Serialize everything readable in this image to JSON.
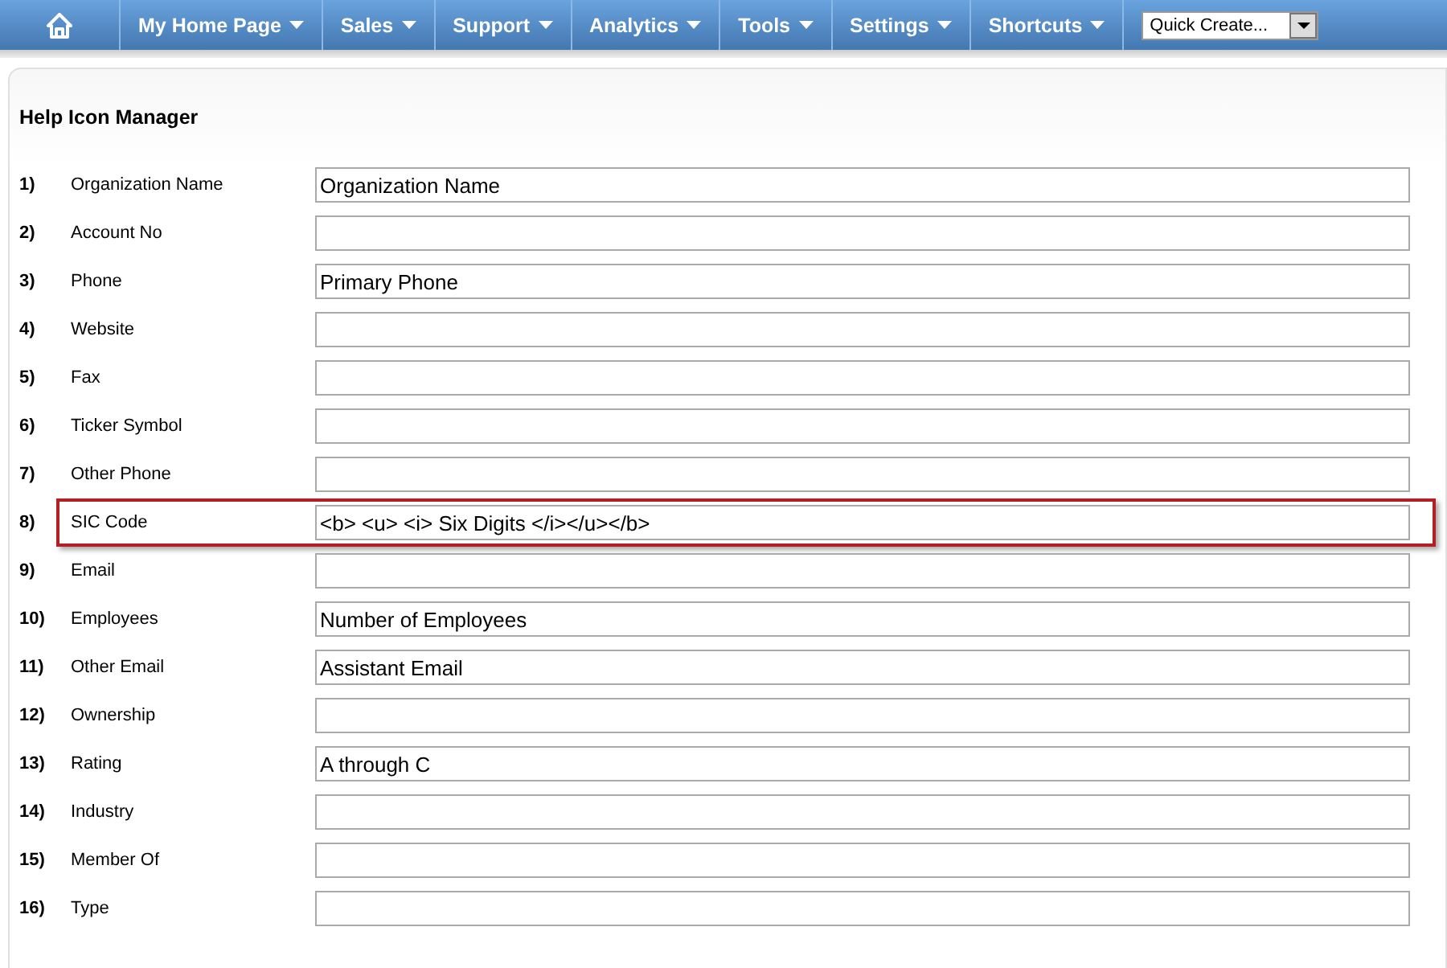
{
  "nav": {
    "items": [
      {
        "label": "My Home Page"
      },
      {
        "label": "Sales"
      },
      {
        "label": "Support"
      },
      {
        "label": "Analytics"
      },
      {
        "label": "Tools"
      },
      {
        "label": "Settings"
      },
      {
        "label": "Shortcuts"
      }
    ],
    "quick_create": "Quick Create..."
  },
  "page": {
    "title": "Help Icon Manager"
  },
  "rows": [
    {
      "number": "1)",
      "label": "Organization Name",
      "value": "Organization Name",
      "highlighted": false
    },
    {
      "number": "2)",
      "label": "Account No",
      "highlighted": false
    },
    {
      "number": "3)",
      "label": "Phone",
      "value": "Primary Phone",
      "highlighted": false
    },
    {
      "number": "4)",
      "label": "Website",
      "highlighted": false
    },
    {
      "number": "5)",
      "label": "Fax",
      "highlighted": false
    },
    {
      "number": "6)",
      "label": "Ticker Symbol",
      "highlighted": false
    },
    {
      "number": "7)",
      "label": "Other Phone",
      "highlighted": false
    },
    {
      "number": "8)",
      "label": "SIC Code",
      "value": "<b> <u> <i> Six Digits </i></u></b>",
      "highlighted": true
    },
    {
      "number": "9)",
      "label": "Email",
      "highlighted": false
    },
    {
      "number": "10)",
      "label": "Employees",
      "value": "Number of Employees",
      "highlighted": false
    },
    {
      "number": "11)",
      "label": "Other Email",
      "value": "Assistant Email",
      "highlighted": false
    },
    {
      "number": "12)",
      "label": "Ownership",
      "highlighted": false
    },
    {
      "number": "13)",
      "label": "Rating",
      "value": "A through C",
      "highlighted": false
    },
    {
      "number": "14)",
      "label": "Industry",
      "highlighted": false
    },
    {
      "number": "15)",
      "label": "Member Of",
      "highlighted": false
    },
    {
      "number": "16)",
      "label": "Type",
      "highlighted": false
    }
  ]
}
